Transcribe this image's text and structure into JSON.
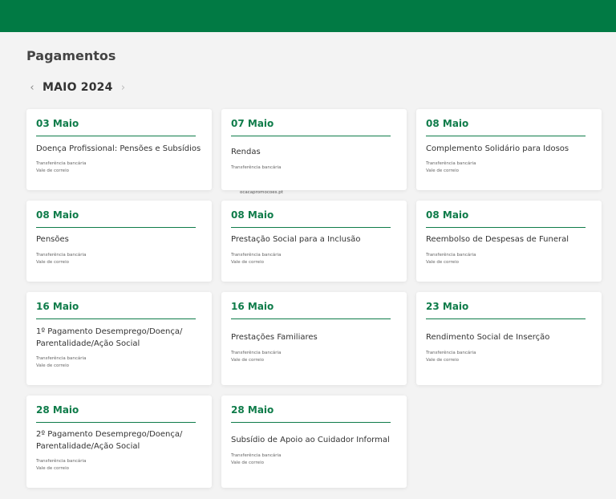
{
  "header": {
    "title": "Pagamentos"
  },
  "month_nav": {
    "prev_icon": "‹",
    "label": "MAIO 2024",
    "next_icon": "›"
  },
  "watermark": "ocacapromocoes.pt",
  "cards": [
    {
      "date": "03 Maio",
      "title": "Doença Profissional: Pensões e Subsídios",
      "methods": [
        "Transferência bancária",
        "Vale de correio"
      ]
    },
    {
      "date": "07 Maio",
      "title": "Rendas",
      "methods": [
        "Transferência bancária"
      ]
    },
    {
      "date": "08 Maio",
      "title": "Complemento Solidário para Idosos",
      "methods": [
        "Transferência bancária",
        "Vale de correio"
      ]
    },
    {
      "date": "08 Maio",
      "title": "Pensões",
      "methods": [
        "Transferência bancária",
        "Vale de correio"
      ]
    },
    {
      "date": "08 Maio",
      "title": "Prestação Social para a Inclusão",
      "methods": [
        "Transferência bancária",
        "Vale de correio"
      ]
    },
    {
      "date": "08 Maio",
      "title": "Reembolso de Despesas de Funeral",
      "methods": [
        "Transferência bancária",
        "Vale de correio"
      ]
    },
    {
      "date": "16 Maio",
      "title": "1º Pagamento Desemprego/Doença/ Parentalidade/Ação Social",
      "methods": [
        "Transferência bancária",
        "Vale de correio"
      ]
    },
    {
      "date": "16 Maio",
      "title": "Prestações Familiares",
      "methods": [
        "Transferência bancária",
        "Vale de correio"
      ]
    },
    {
      "date": "23 Maio",
      "title": "Rendimento Social de Inserção",
      "methods": [
        "Transferência bancária",
        "Vale de correio"
      ]
    },
    {
      "date": "28 Maio",
      "title": "2º Pagamento Desemprego/Doença/ Parentalidade/Ação Social",
      "methods": [
        "Transferência bancária",
        "Vale de correio"
      ]
    },
    {
      "date": "28 Maio",
      "title": "Subsídio de Apoio ao Cuidador Informal",
      "methods": [
        "Transferência bancária",
        "Vale de correio"
      ]
    }
  ]
}
